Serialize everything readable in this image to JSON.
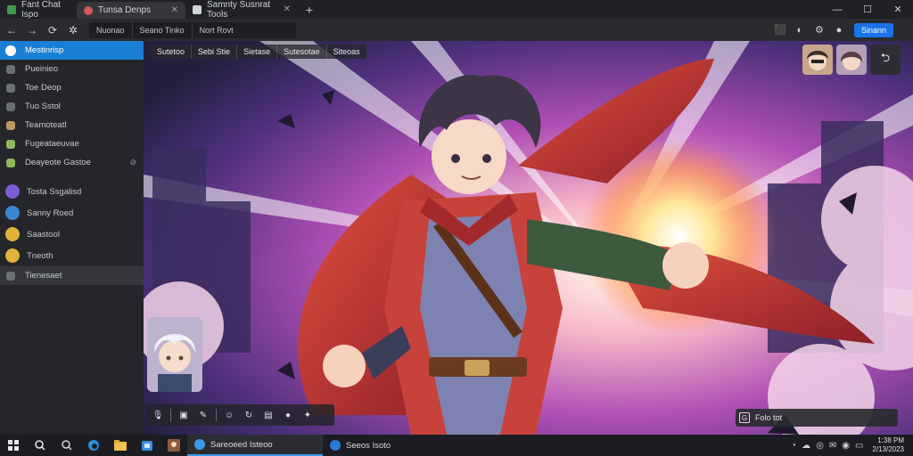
{
  "tabs": [
    {
      "title": "Fant Chat Ispo",
      "icon": "shield-icon",
      "color": "#4caf50"
    },
    {
      "title": "Tunsa Denps",
      "icon": "app-icon",
      "color": "#e57373",
      "close": "✕"
    },
    {
      "title": "Samnty Susnrat Tools",
      "icon": "lock-icon",
      "color": "#cfd3d8",
      "close": "✕"
    }
  ],
  "new_tab": "+",
  "window_controls": {
    "minimize": "—",
    "maximize": "☐",
    "close": "✕"
  },
  "toolbar": {
    "address_segments": [
      "Nuonao",
      "Seano Tinko",
      "Nort Rovt"
    ],
    "signin_label": "Sinann"
  },
  "sidebar": {
    "items": [
      {
        "label": "Mestinrisp",
        "icon": "discord-icon",
        "color": "#ffffff",
        "state": "active",
        "shape": "round"
      },
      {
        "label": "Pueinieo",
        "icon": "hash-icon",
        "color": "#6b6f76",
        "shape": "sq"
      },
      {
        "label": "Toe Deop",
        "icon": "hash-icon",
        "color": "#6b6f76",
        "shape": "sq"
      },
      {
        "label": "Tuo Sstol",
        "icon": "hash-icon",
        "color": "#6b6f76",
        "shape": "sq"
      },
      {
        "label": "Teamoteatl",
        "icon": "folder-icon",
        "color": "#b89b5e",
        "shape": "sq"
      },
      {
        "label": "Fugeataeuvae",
        "icon": "folder-icon",
        "color": "#8fb85e",
        "shape": "sq"
      },
      {
        "label": "Deayeote Gastoe",
        "icon": "folder-icon",
        "color": "#8fb85e",
        "shape": "sq",
        "more": "⊘"
      },
      {
        "label": "Tosta Ssgalisd",
        "icon": "server-icon",
        "color": "#7c5cd6",
        "shape": "big"
      },
      {
        "label": "Sanny Roed",
        "icon": "server-icon",
        "color": "#3b86d6",
        "shape": "big"
      },
      {
        "label": "Saastool",
        "icon": "server-icon",
        "color": "#e0b23a",
        "shape": "big"
      },
      {
        "label": "Tneoth",
        "icon": "server-icon",
        "color": "#e0b23a",
        "shape": "big"
      },
      {
        "label": "Tienesaet",
        "icon": "channel-icon",
        "color": "#6b6f76",
        "shape": "sq",
        "state": "selected"
      }
    ]
  },
  "main": {
    "chips": [
      "Sutetoo",
      "Sebi Stie",
      "Sietase",
      "Sutesotae",
      "Siteoas"
    ],
    "message_placeholder": "Folo tot"
  },
  "taskbar": {
    "apps": [
      {
        "label": "Sareoeed Isteoo",
        "color": "#3c9ae8",
        "state": "active"
      },
      {
        "label": "Seeos Isoto",
        "color": "#2a7bd6",
        "state": "normal"
      }
    ],
    "clock_time": "1:38 PM",
    "clock_date": "2/13/2023"
  }
}
